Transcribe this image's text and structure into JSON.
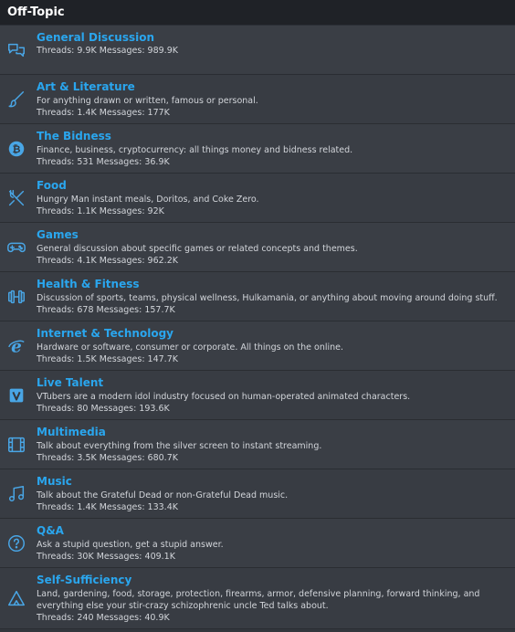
{
  "category": {
    "title": "Off-Topic"
  },
  "colors": {
    "accent": "#2aa6ee",
    "header_bg": "#1f2227",
    "row_bg": "#3a3e45",
    "text": "#d2d5da"
  },
  "nodes": [
    {
      "title": "General Discussion",
      "description": "",
      "threads": "Threads: 9.9K",
      "messages": "Messages: 989.9K",
      "icon": "chat-bubbles-icon"
    },
    {
      "title": "Art & Literature",
      "description": "For anything drawn or written, famous or personal.",
      "threads": "Threads: 1.4K",
      "messages": "Messages: 177K",
      "icon": "paintbrush-icon"
    },
    {
      "title": "The Bidness",
      "description": "Finance, business, cryptocurrency: all things money and bidness related.",
      "threads": "Threads: 531",
      "messages": "Messages: 36.9K",
      "icon": "bitcoin-icon"
    },
    {
      "title": "Food",
      "description": "Hungry Man instant meals, Doritos, and Coke Zero.",
      "threads": "Threads: 1.1K",
      "messages": "Messages: 92K",
      "icon": "utensils-icon"
    },
    {
      "title": "Games",
      "description": "General discussion about specific games or related concepts and themes.",
      "threads": "Threads: 4.1K",
      "messages": "Messages: 962.2K",
      "icon": "gamepad-icon"
    },
    {
      "title": "Health & Fitness",
      "description": "Discussion of sports, teams, physical wellness, Hulkamania, or anything about moving around doing stuff.",
      "threads": "Threads: 678",
      "messages": "Messages: 157.7K",
      "icon": "dumbbell-icon"
    },
    {
      "title": "Internet & Technology",
      "description": "Hardware or software, consumer or corporate. All things on the online.",
      "threads": "Threads: 1.5K",
      "messages": "Messages: 147.7K",
      "icon": "internet-explorer-icon"
    },
    {
      "title": "Live Talent",
      "description": "VTubers are a modern idol industry focused on human-operated animated characters.",
      "threads": "Threads: 80",
      "messages": "Messages: 193.6K",
      "icon": "vtuber-v-icon"
    },
    {
      "title": "Multimedia",
      "description": "Talk about everything from the silver screen to instant streaming.",
      "threads": "Threads: 3.5K",
      "messages": "Messages: 680.7K",
      "icon": "film-icon"
    },
    {
      "title": "Music",
      "description": "Talk about the Grateful Dead or non-Grateful Dead music.",
      "threads": "Threads: 1.4K",
      "messages": "Messages: 133.4K",
      "icon": "music-note-icon"
    },
    {
      "title": "Q&A",
      "description": "Ask a stupid question, get a stupid answer.",
      "threads": "Threads: 30K",
      "messages": "Messages: 409.1K",
      "icon": "question-circle-icon"
    },
    {
      "title": "Self-Sufficiency",
      "description": "Land, gardening, food, storage, protection, firearms, armor, defensive planning, forward thinking, and everything else your stir-crazy schizophrenic uncle Ted talks about.",
      "threads": "Threads: 240",
      "messages": "Messages: 40.9K",
      "icon": "campfire-tent-icon"
    }
  ]
}
